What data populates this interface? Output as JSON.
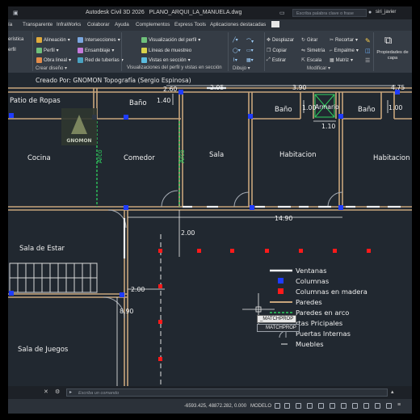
{
  "titlebar": {
    "app": "Autodesk Civil 3D 2026",
    "file": "PLANO_ARQUI_LA_MANUELA.dwg",
    "search_placeholder": "Escriba palabra clave o frase",
    "user": "siri_javier"
  },
  "menubar": [
    "ía",
    "Transparente",
    "InfraWorks",
    "Colaborar",
    "Ayuda",
    "Complementos",
    "Express Tools",
    "Aplicaciones destacadas"
  ],
  "ribbon": {
    "left_tools": [
      "erística",
      "erfil"
    ],
    "create": [
      "Alineación",
      "Intersecciones",
      "Perfil",
      "Ensamblaje",
      "Obra lineal",
      "Red de tuberías"
    ],
    "profile_views": [
      "Visualización del perfil",
      "Líneas de muestreo",
      "Vistas en sección"
    ],
    "modify": [
      "Desplazar",
      "Girar",
      "Recortar",
      "Copiar",
      "Simetría",
      "Empalme",
      "Estirar",
      "Escala",
      "Matriz"
    ],
    "properties": "Propiedades de capa",
    "groups": {
      "create": "Crear diseño",
      "views": "Visualizaciones del perfil y vistas en sección",
      "draw": "Dibujo",
      "modify": "Modificar"
    }
  },
  "drawing": {
    "credit": "Creado Por: GNOMON Topografía (Sergio Espinosa)",
    "logo_text": "GNOMON",
    "rooms": {
      "patio": "Patio de Ropas",
      "bano1": "Baño",
      "bano2": "Baño",
      "bano3": "Baño",
      "armario": "Armario",
      "cocina": "Cocina",
      "comedor": "Comedor",
      "sala": "Sala",
      "habitacion1": "Habitacion",
      "habitacion2": "Habitacion",
      "sala_estar": "Sala de Estar",
      "sala_juegos": "Sala de Juegos",
      "arco1": "Arco",
      "arco2": "Arco"
    },
    "dims": {
      "d260": "2.60",
      "d295": "2.95",
      "d390": "3.90",
      "d475": "4.75",
      "d140": "1.40",
      "d100a": "1.00",
      "d100b": "1.00",
      "d110": "1.10",
      "d1490": "14.90",
      "d200a": "2.00",
      "d200b": "2.00",
      "d890": "8.90"
    },
    "legend": [
      "Ventanas",
      "Columnas",
      "Columnas en madera",
      "Paredes",
      "Paredes en arco",
      "rtas Pricipales",
      "Puertas Internas",
      "Muebles"
    ],
    "tooltip1": "_MATCHPROP",
    "tooltip2": "MATCHPROP"
  },
  "cmdline": {
    "placeholder": "Escriba un comando"
  },
  "statusbar": {
    "coords": "-6593.425, 48872.282, 0.000",
    "mode": "MODELO"
  },
  "colors": {
    "background": "#212830",
    "wall": "#c8a57c",
    "column": "#1f3cff",
    "wood_column": "#ff1a1a",
    "arc_text": "#2fd060"
  }
}
